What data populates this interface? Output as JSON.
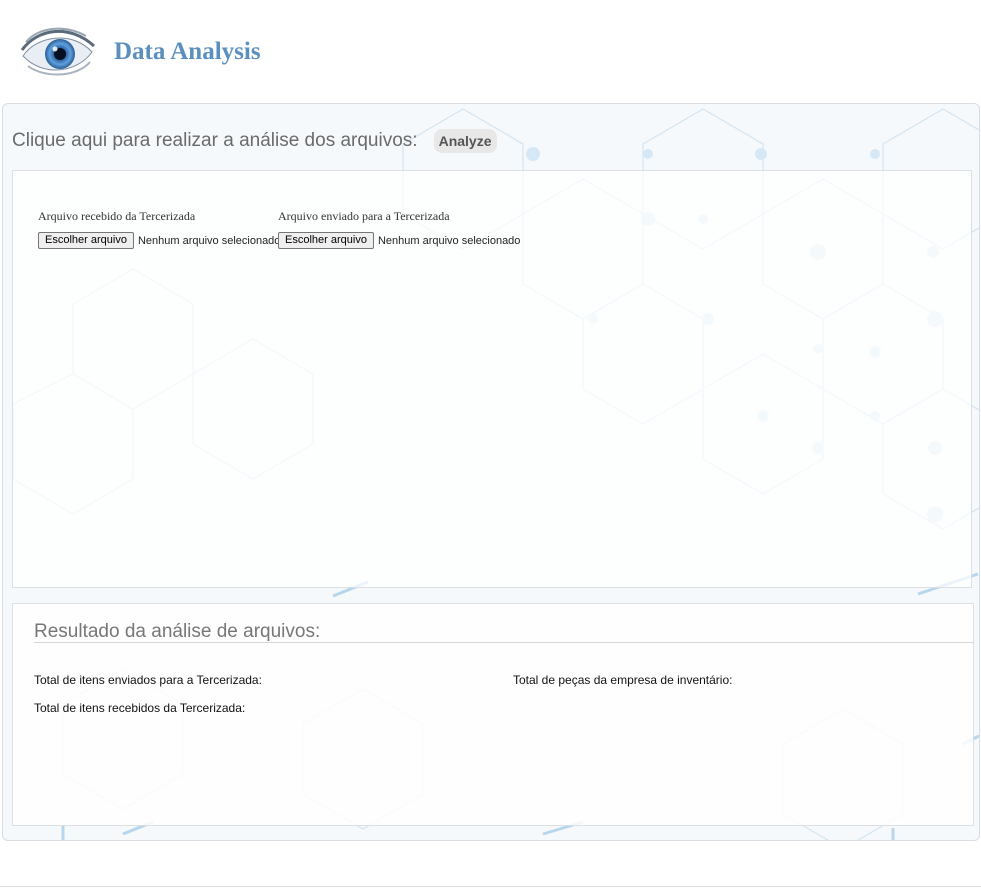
{
  "header": {
    "title": "Data Analysis",
    "logo_icon": "eye-logo-icon"
  },
  "analyze_section": {
    "prompt": "Clique aqui para realizar a análise dos arquivos:",
    "button_label": "Analyze"
  },
  "uploads": [
    {
      "label": "Arquivo recebido da Tercerizada",
      "button_label": "Escolher arquivo",
      "status": "Nenhum arquivo selecionado"
    },
    {
      "label": "Arquivo enviado para a Tercerizada",
      "button_label": "Escolher arquivo",
      "status": "Nenhum arquivo selecionado"
    }
  ],
  "results": {
    "title": "Resultado da análise de arquivos:",
    "total_sent": "Total de itens enviados para a Tercerizada:",
    "total_received": "Total de itens recebidos da Tercerizada:",
    "total_inventory": "Total de peças da empresa de inventário:"
  },
  "colors": {
    "title": "#5b8fbe",
    "pattern": "#cfe3f2",
    "panel_border": "#d9dde2"
  }
}
